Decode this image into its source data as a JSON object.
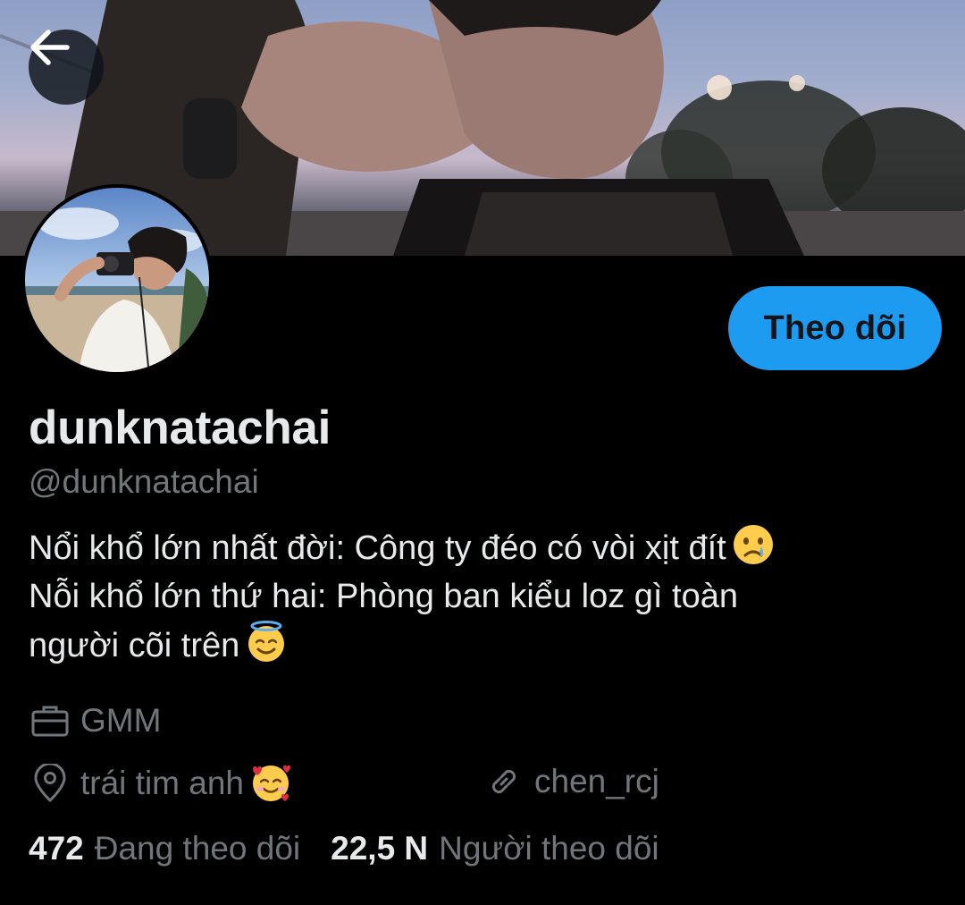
{
  "header": {
    "back_icon": "arrow-left-icon",
    "banner_description_colors": {
      "sky_top": "#8e9fc6",
      "sky_bottom": "#c7b9cc"
    }
  },
  "profile": {
    "display_name": "dunknatachai",
    "handle": "@dunknatachai",
    "follow_label": "Theo dõi",
    "bio_lines": [
      "Nổi khổ lớn nhất đời: Công ty đéo có vòi xịt đít",
      "Nỗi khổ lớn thứ hai: Phòng ban kiểu loz gì toàn",
      "người cõi trên"
    ],
    "bio_emojis": [
      "crying-face-emoji",
      "smiling-face-with-halo-emoji"
    ],
    "work": {
      "icon": "briefcase-icon",
      "text": "GMM"
    },
    "location": {
      "icon": "location-pin-icon",
      "text": "trái tim anh",
      "emoji": "smiling-face-with-hearts-emoji"
    },
    "website": {
      "icon": "link-icon",
      "text": "chen_rcj"
    },
    "stats": {
      "following_count": "472",
      "following_label": "Đang theo dõi",
      "followers_count": "22,5 N",
      "followers_label": "Người theo dõi"
    }
  },
  "colors": {
    "accent": "#1d9bf0",
    "background": "#000000",
    "text_primary": "#e7e9ea",
    "text_secondary": "#71767b"
  }
}
